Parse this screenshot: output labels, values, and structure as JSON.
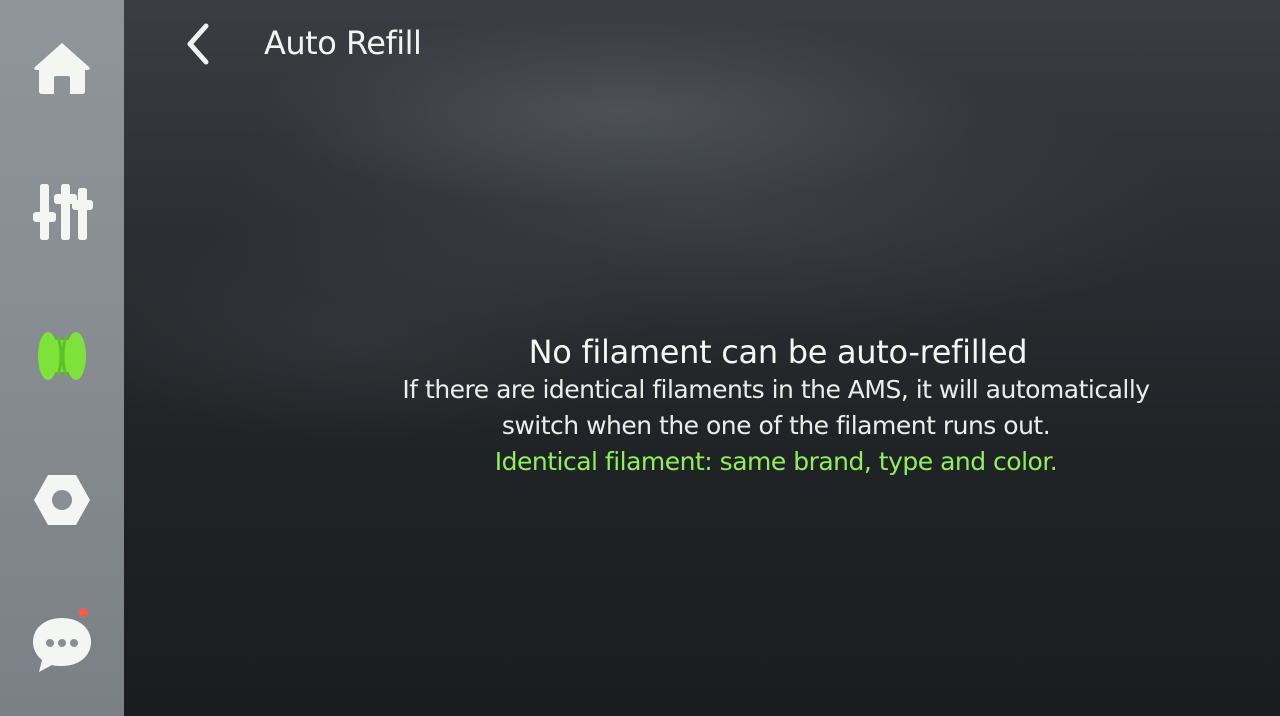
{
  "header": {
    "title": "Auto Refill",
    "back_icon": "chevron-left-icon"
  },
  "sidebar": {
    "items": [
      {
        "id": "home",
        "icon": "home-icon",
        "active": false
      },
      {
        "id": "controls",
        "icon": "sliders-icon",
        "active": false
      },
      {
        "id": "filament",
        "icon": "filament-spool-icon",
        "active": true
      },
      {
        "id": "settings",
        "icon": "hexagon-gear-icon",
        "active": false
      },
      {
        "id": "messages",
        "icon": "chat-bubble-icon",
        "active": false,
        "has_notification": true
      }
    ]
  },
  "message": {
    "title": "No filament can be auto-refilled",
    "body_line1": "If there are identical filaments in the AMS, it will automatically",
    "body_line2": "switch when the one of the filament runs out.",
    "hint": "Identical filament: same brand, type and color."
  },
  "colors": {
    "accent": "#8ff05a",
    "text": "#f2f4f1",
    "sidebar_bg": "#8a9094",
    "icon": "#f4f6f4",
    "notification": "#ff5a4a"
  }
}
